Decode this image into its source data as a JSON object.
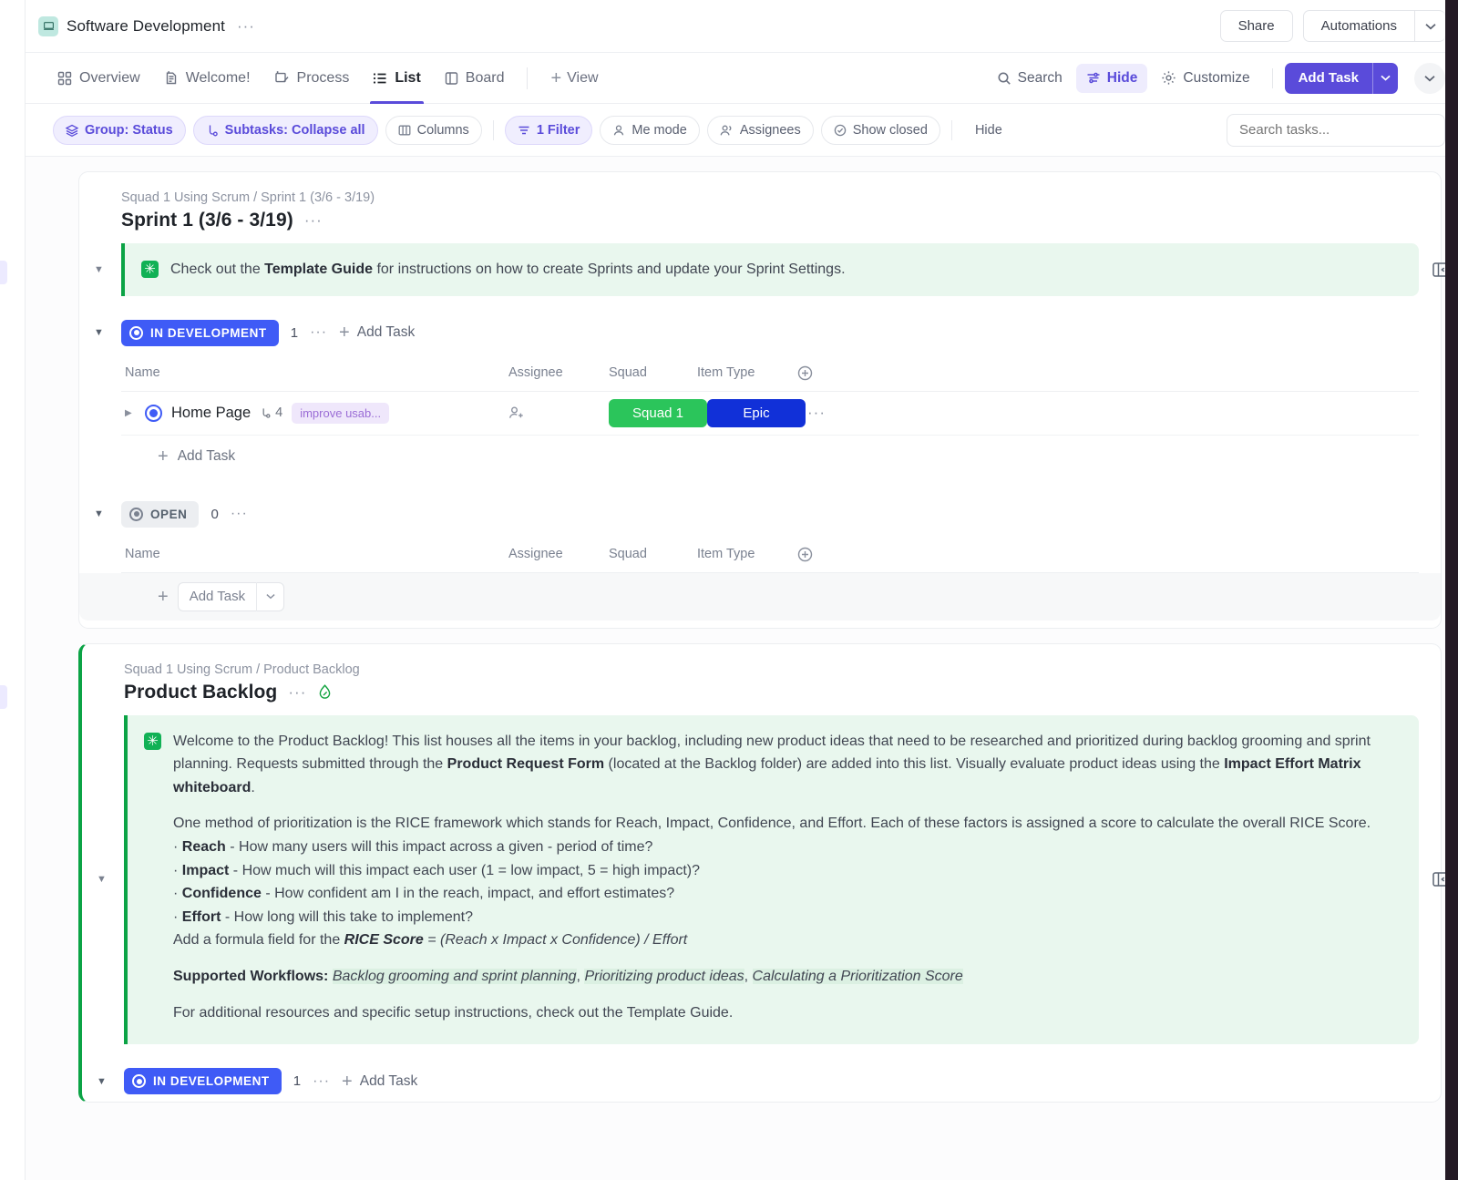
{
  "header": {
    "workspace_icon": "laptop-icon",
    "title": "Software Development",
    "more_label": "···",
    "share_label": "Share",
    "automations_label": "Automations",
    "automations_caret": "chevron-down-icon"
  },
  "views": {
    "tabs": [
      {
        "label": "Overview",
        "icon": "grid-icon",
        "active": false
      },
      {
        "label": "Welcome!",
        "icon": "doc-pin-icon",
        "active": false
      },
      {
        "label": "Process",
        "icon": "whiteboard-pin-icon",
        "active": false
      },
      {
        "label": "List",
        "icon": "list-icon",
        "active": true
      },
      {
        "label": "Board",
        "icon": "board-icon",
        "active": false
      }
    ],
    "add_view_label": "View",
    "search_label": "Search",
    "hide_label": "Hide",
    "customize_label": "Customize",
    "add_task_label": "Add Task"
  },
  "filters": {
    "chips": [
      {
        "label": "Group: Status",
        "icon": "layers-icon",
        "highlight": true
      },
      {
        "label": "Subtasks: Collapse all",
        "icon": "subtask-icon",
        "highlight": true
      },
      {
        "label": "Columns",
        "icon": "columns-icon",
        "highlight": false
      },
      {
        "label": "1 Filter",
        "icon": "filter-icon",
        "highlight": true
      },
      {
        "label": "Me mode",
        "icon": "person-icon",
        "highlight": false
      },
      {
        "label": "Assignees",
        "icon": "people-icon",
        "highlight": false
      },
      {
        "label": "Show closed",
        "icon": "check-circle-icon",
        "highlight": false
      },
      {
        "label": "Hide",
        "icon": "none",
        "highlight": false,
        "plain": true
      }
    ],
    "search_placeholder": "Search tasks...",
    "search_value": ""
  },
  "columns": {
    "name": "Name",
    "assignee": "Assignee",
    "squad": "Squad",
    "item_type": "Item Type",
    "add_column": "plus-circle-icon"
  },
  "colors": {
    "accent_purple": "#5a4bda",
    "status_dev": "#3f5bf6",
    "status_open": "#eceef1",
    "squad_green": "#2bc55b",
    "epic_blue": "#1130d8",
    "banner_green": "#0ba345",
    "tag_purple": "#9b6dd6"
  },
  "lists": [
    {
      "breadcrumb": "Squad 1 Using Scrum / Sprint 1 (3/6 - 3/19)",
      "title": "Sprint 1 (3/6 - 3/19)",
      "more": "···",
      "banner": {
        "icon": "sparkle-icon",
        "line": "Check out the Template Guide for instructions on how to create Sprints and update your Sprint Settings.",
        "pre": "Check out the ",
        "bold": "Template Guide",
        "post": " for instructions on how to create Sprints and update your Sprint Settings."
      },
      "groups": [
        {
          "status": "IN DEVELOPMENT",
          "status_style": "dev",
          "count": "1",
          "dots": "···",
          "add_task": "Add Task",
          "tasks": [
            {
              "name": "Home Page",
              "subtask_count": "4",
              "tag": "improve usab...",
              "assignee": "add-assignee-icon",
              "squad": "Squad 1",
              "item_type": "Epic",
              "row_more": "···"
            }
          ],
          "footer_add_task": "Add Task",
          "footer_style": "plain"
        },
        {
          "status": "OPEN",
          "status_style": "open",
          "count": "0",
          "dots": "···",
          "add_task": "",
          "tasks": [],
          "footer_add_task": "Add Task",
          "footer_style": "shaded"
        }
      ]
    },
    {
      "breadcrumb": "Squad 1 Using Scrum / Product Backlog",
      "title": "Product Backlog",
      "more": "···",
      "badge_icon": "drop-icon",
      "banner": {
        "icon": "sparkle-icon",
        "p1_a": "Welcome to the Product Backlog! This list houses all the items in your backlog, including new product ideas that need to be researched and prioritized during backlog grooming and sprint planning. Requests submitted through the ",
        "p1_b": "Product Request Form",
        "p1_c": " (located at the Backlog folder) are added into this list. Visually evaluate product ideas using the ",
        "p1_d": "Impact Effort Matrix whiteboard",
        "p1_e": ".",
        "p2": "One method of prioritization is the RICE framework which stands for Reach, Impact, Confidence, and Effort. Each of these factors is assigned a score to calculate the overall RICE Score.",
        "bullets": [
          {
            "term": "Reach",
            "desc": " - How many users will this impact across a given - period of time?"
          },
          {
            "term": "Impact",
            "desc": " - How much will this impact each user (1 = low impact, 5 = high impact)?"
          },
          {
            "term": "Confidence",
            "desc": " - How confident am I in the reach, impact, and effort estimates?"
          },
          {
            "term": "Effort",
            "desc": " - How long will this take to implement?"
          }
        ],
        "formula_pre": "Add a formula field for the ",
        "formula_bold": "RICE Score",
        "formula_post": " = (Reach x Impact x Confidence) / Effort",
        "workflows_label": "Supported Workflows: ",
        "workflows": [
          "Backlog grooming and sprint planning",
          "Prioritizing product ideas",
          "Calculating a Prioritization Score"
        ],
        "closing": "For additional resources and specific setup instructions, check out the Template Guide."
      },
      "groups": [
        {
          "status": "IN DEVELOPMENT",
          "status_style": "dev",
          "count": "1",
          "dots": "···",
          "add_task": "Add Task",
          "tasks": [],
          "footer_add_task": "",
          "footer_style": "none"
        }
      ]
    }
  ]
}
